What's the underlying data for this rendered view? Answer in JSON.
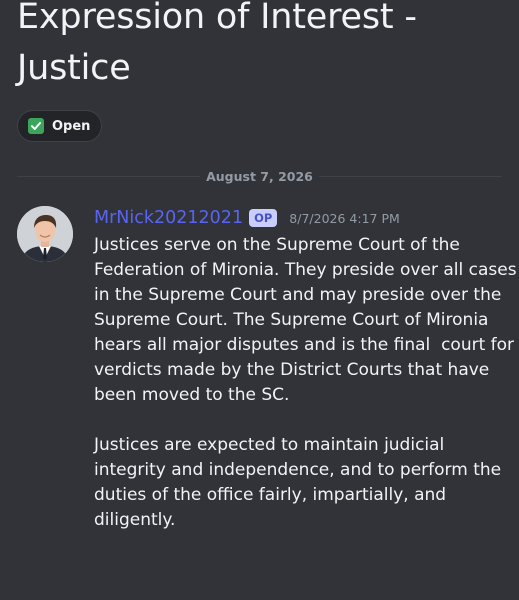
{
  "thread": {
    "title": "Expression of Interest - Justice",
    "tag": {
      "label": "Open",
      "icon": "check-box-icon",
      "color": "#3ba55c"
    }
  },
  "divider": {
    "date": "August 7, 2026"
  },
  "message": {
    "author": "MrNick20212021",
    "badge": "OP",
    "timestamp": "8/7/2026 4:17 PM",
    "paragraphs": [
      "Justices serve on the Supreme Court of the Federation of Mironia. They preside over all cases in the Supreme Court and may preside over the Supreme Court. The Supreme Court of Mironia hears all major disputes and is the final  court for verdicts made by the District Courts that have been moved to the SC.",
      "Justices are expected to maintain judicial integrity and independence, and to perform the duties of the office fairly, impartially, and diligently."
    ]
  },
  "colors": {
    "background": "#313338",
    "accent": "#5865f2",
    "text": "#f2f3f5",
    "muted": "#949ba4"
  }
}
